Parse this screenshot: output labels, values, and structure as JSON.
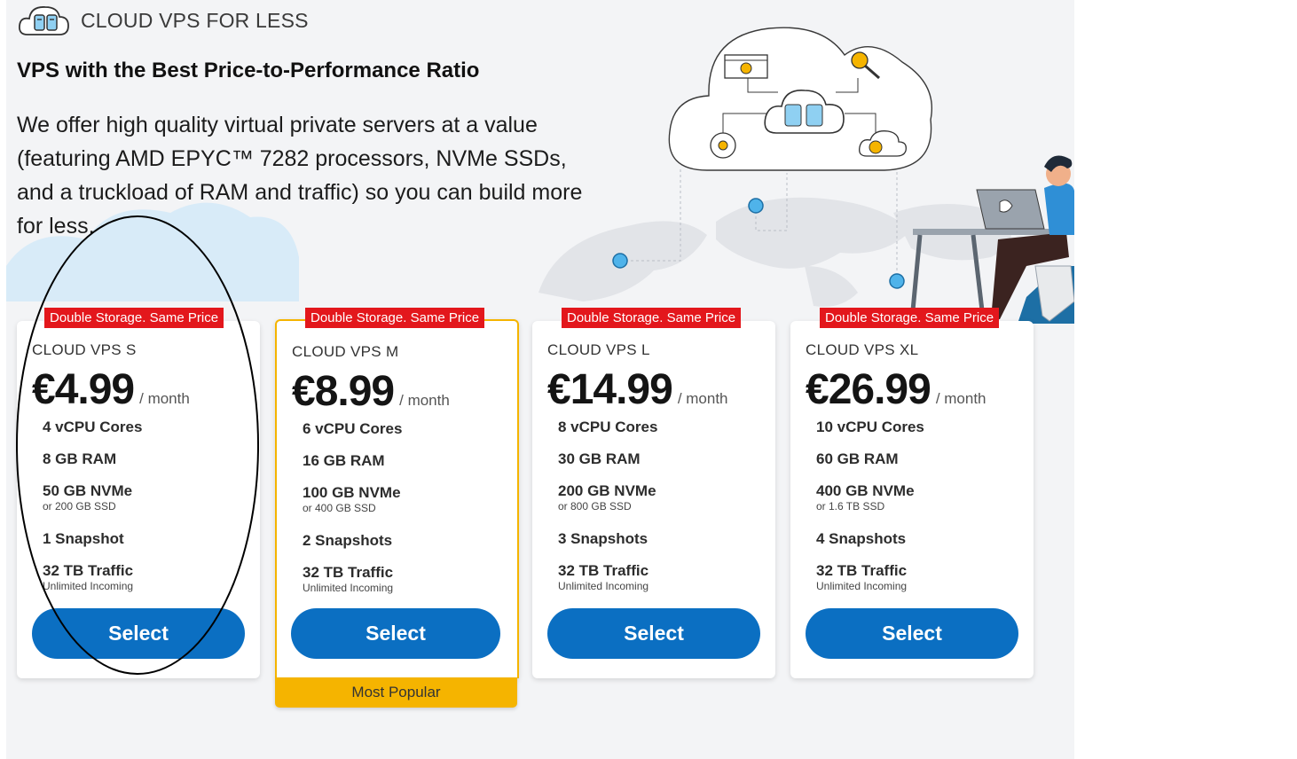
{
  "brand": {
    "text": "CLOUD VPS FOR LESS",
    "icon": "cloud-server-icon"
  },
  "headline": "VPS with the Best Price-to-Performance Ratio",
  "intro": "We offer high quality virtual private servers at a value (featuring AMD EPYC™ 7282 processors, NVMe SSDs, and a truckload of RAM and traffic) so you can build more for less.",
  "colors": {
    "accent_blue": "#0b6fc2",
    "badge_red": "#e3171c",
    "popular_yellow": "#f5b400"
  },
  "plans": [
    {
      "badge": "Double Storage. Same Price",
      "name": "CLOUD VPS S",
      "price": "€4.99",
      "period": "/ month",
      "cores": "4 vCPU Cores",
      "ram": "8 GB RAM",
      "storage": "50 GB NVMe",
      "storage_alt": "or 200 GB SSD",
      "snapshots": "1 Snapshot",
      "traffic": "32 TB Traffic",
      "traffic_sub": "Unlimited Incoming",
      "button": "Select"
    },
    {
      "badge": "Double Storage. Same Price",
      "name": "CLOUD VPS M",
      "price": "€8.99",
      "period": "/ month",
      "cores": "6 vCPU Cores",
      "ram": "16 GB RAM",
      "storage": "100 GB NVMe",
      "storage_alt": "or 400 GB SSD",
      "snapshots": "2 Snapshots",
      "traffic": "32 TB Traffic",
      "traffic_sub": "Unlimited Incoming",
      "button": "Select",
      "ribbon": "Most Popular"
    },
    {
      "badge": "Double Storage. Same Price",
      "name": "CLOUD VPS L",
      "price": "€14.99",
      "period": "/ month",
      "cores": "8 vCPU Cores",
      "ram": "30 GB RAM",
      "storage": "200 GB NVMe",
      "storage_alt": "or 800 GB SSD",
      "snapshots": "3 Snapshots",
      "traffic": "32 TB Traffic",
      "traffic_sub": "Unlimited Incoming",
      "button": "Select"
    },
    {
      "badge": "Double Storage. Same Price",
      "name": "CLOUD VPS XL",
      "price": "€26.99",
      "period": "/ month",
      "cores": "10 vCPU Cores",
      "ram": "60 GB RAM",
      "storage": "400 GB NVMe",
      "storage_alt": "or 1.6 TB SSD",
      "snapshots": "4 Snapshots",
      "traffic": "32 TB Traffic",
      "traffic_sub": "Unlimited Incoming",
      "button": "Select"
    }
  ]
}
